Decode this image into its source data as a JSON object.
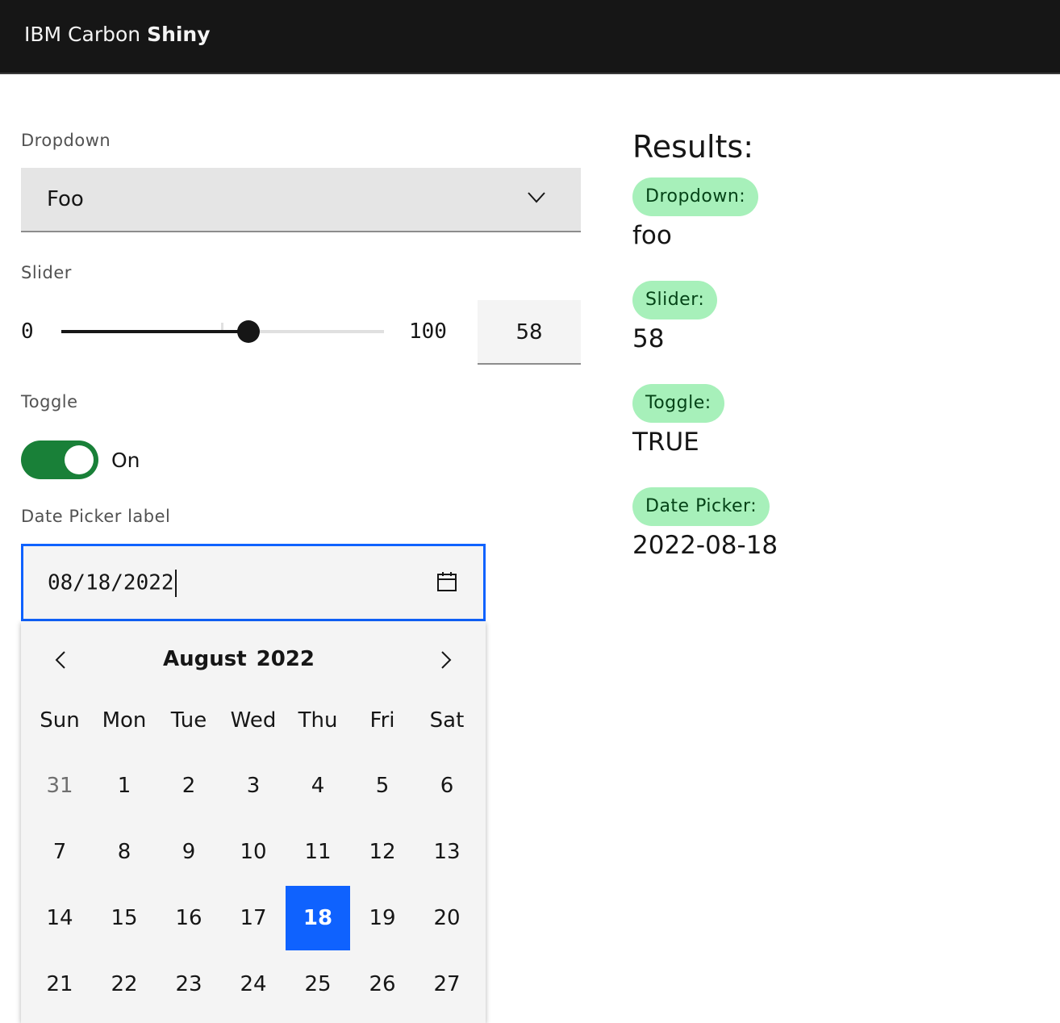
{
  "header": {
    "brand_prefix": "IBM Carbon ",
    "brand_name": "Shiny"
  },
  "dropdown": {
    "label": "Dropdown",
    "value": "Foo",
    "icon": "chevron-down-icon"
  },
  "slider": {
    "label": "Slider",
    "min": "0",
    "max": "100",
    "value": "58",
    "fraction": 0.58
  },
  "toggle": {
    "label": "Toggle",
    "state_text": "On",
    "checked": true,
    "color": "#198038"
  },
  "date_picker": {
    "label": "Date Picker label",
    "value": "08/18/2022",
    "icon": "calendar-icon",
    "calendar": {
      "month": "August",
      "year": "2022",
      "weekdays": [
        "Sun",
        "Mon",
        "Tue",
        "Wed",
        "Thu",
        "Fri",
        "Sat"
      ],
      "weeks": [
        [
          "31",
          "1",
          "2",
          "3",
          "4",
          "5",
          "6"
        ],
        [
          "7",
          "8",
          "9",
          "10",
          "11",
          "12",
          "13"
        ],
        [
          "14",
          "15",
          "16",
          "17",
          "18",
          "19",
          "20"
        ],
        [
          "21",
          "22",
          "23",
          "24",
          "25",
          "26",
          "27"
        ]
      ],
      "other_month_days": [
        "31"
      ],
      "selected_day": "18",
      "selected_color": "#0f62fe"
    }
  },
  "results": {
    "title": "Results:",
    "items": [
      {
        "tag": "Dropdown:",
        "value": "foo"
      },
      {
        "tag": "Slider:",
        "value": "58"
      },
      {
        "tag": "Toggle:",
        "value": "TRUE"
      },
      {
        "tag": "Date Picker:",
        "value": "2022-08-18"
      }
    ],
    "tag_color": "#a7f0ba"
  }
}
